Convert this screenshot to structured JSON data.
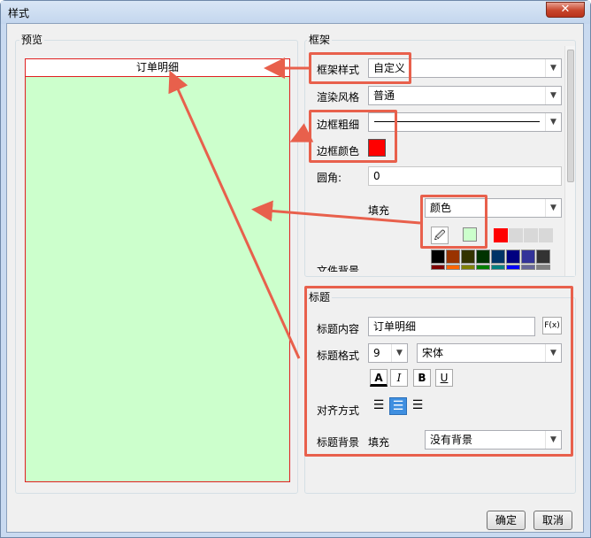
{
  "window": {
    "title": "样式",
    "close_glyph": "✕"
  },
  "preview": {
    "group_label": "预览",
    "title_text": "订单明细",
    "fill_color": "#ccffcc",
    "border_color": "#e02020"
  },
  "frame": {
    "group_label": "框架",
    "frame_style_label": "框架样式",
    "frame_style_value": "自定义",
    "render_style_label": "渲染风格",
    "render_style_value": "普通",
    "border_width_label": "边框粗细",
    "border_color_label": "边框颜色",
    "border_color_value": "#ff0000",
    "corner_label": "圆角:",
    "corner_value": "0",
    "fill_label": "填充",
    "fill_value": "颜色",
    "fill_color": "#ccffcc",
    "eyedropper_icon": "eyedropper-icon",
    "recent_colors": [
      "#ff0000",
      "#d8d8d8",
      "#d8d8d8",
      "#d8d8d8"
    ],
    "palette_row1": [
      "#000000",
      "#993300",
      "#333300",
      "#003300",
      "#003366",
      "#000080",
      "#333399",
      "#333333"
    ],
    "palette_row2": [
      "#800000",
      "#ff6600",
      "#808000",
      "#008000",
      "#008080",
      "#0000ff",
      "#666699",
      "#808080"
    ],
    "partial_label": "文件背景"
  },
  "title_section": {
    "group_label": "标题",
    "content_label": "标题内容",
    "content_value": "订单明细",
    "formula_icon": "F(x)",
    "format_label": "标题格式",
    "font_size": "9",
    "font_name": "宋体",
    "font_color_btn": "A",
    "italic_btn": "I",
    "bold_btn": "B",
    "underline_btn": "U",
    "align_label": "对齐方式",
    "bg_label": "标题背景",
    "bg_fill_label": "填充",
    "bg_fill_value": "没有背景"
  },
  "buttons": {
    "ok": "确定",
    "cancel": "取消"
  },
  "annotation_color": "#e8604c"
}
